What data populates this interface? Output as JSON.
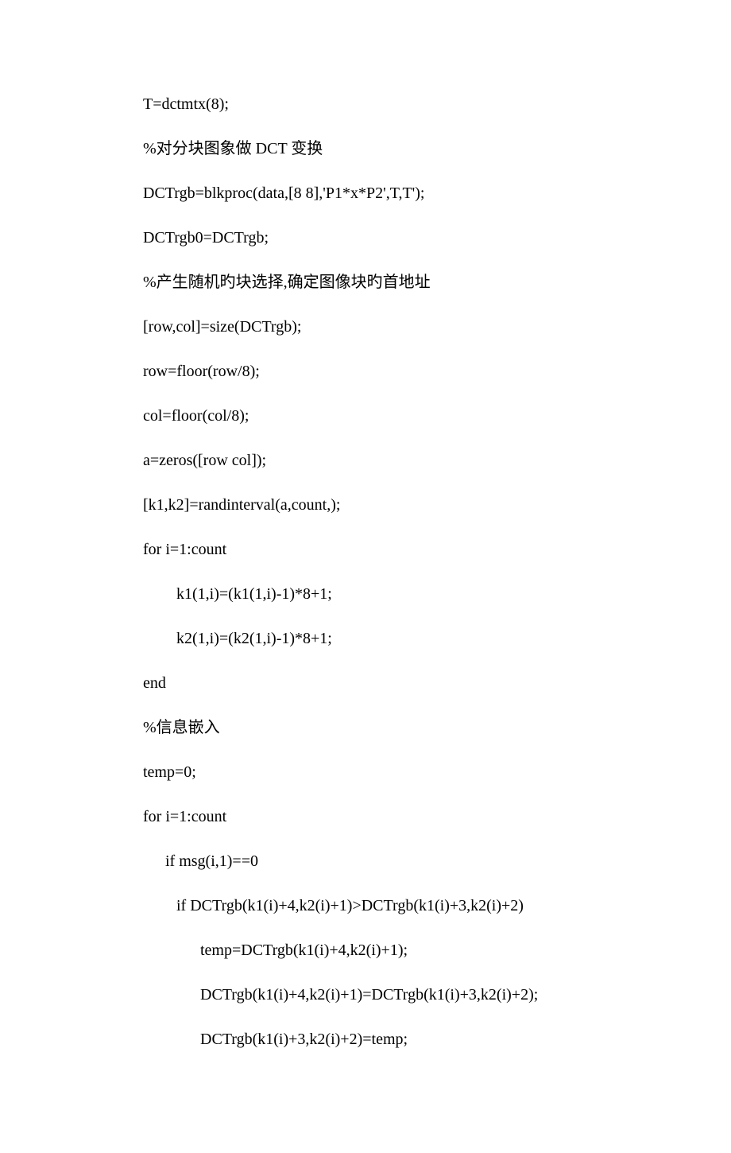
{
  "code": {
    "line1": "T=dctmtx(8);",
    "line2": "%对分块图象做 DCT 变换",
    "line3": "DCTrgb=blkproc(data,[8 8],'P1*x*P2',T,T');",
    "line4": "DCTrgb0=DCTrgb;",
    "line5": "%产生随机旳块选择,确定图像块旳首地址",
    "line6": "[row,col]=size(DCTrgb);",
    "line7": "row=floor(row/8);",
    "line8": "col=floor(col/8);",
    "line9": "a=zeros([row col]);",
    "line10": "[k1,k2]=randinterval(a,count,);",
    "line11": "for i=1:count",
    "line12": "k1(1,i)=(k1(1,i)-1)*8+1;",
    "line13": "k2(1,i)=(k2(1,i)-1)*8+1;",
    "line14": "end",
    "line15": "%信息嵌入",
    "line16": "temp=0;",
    "line17": "for i=1:count",
    "line18": "if msg(i,1)==0",
    "line19": "if DCTrgb(k1(i)+4,k2(i)+1)>DCTrgb(k1(i)+3,k2(i)+2)",
    "line20": "temp=DCTrgb(k1(i)+4,k2(i)+1);",
    "line21": "DCTrgb(k1(i)+4,k2(i)+1)=DCTrgb(k1(i)+3,k2(i)+2);",
    "line22": "DCTrgb(k1(i)+3,k2(i)+2)=temp;"
  }
}
